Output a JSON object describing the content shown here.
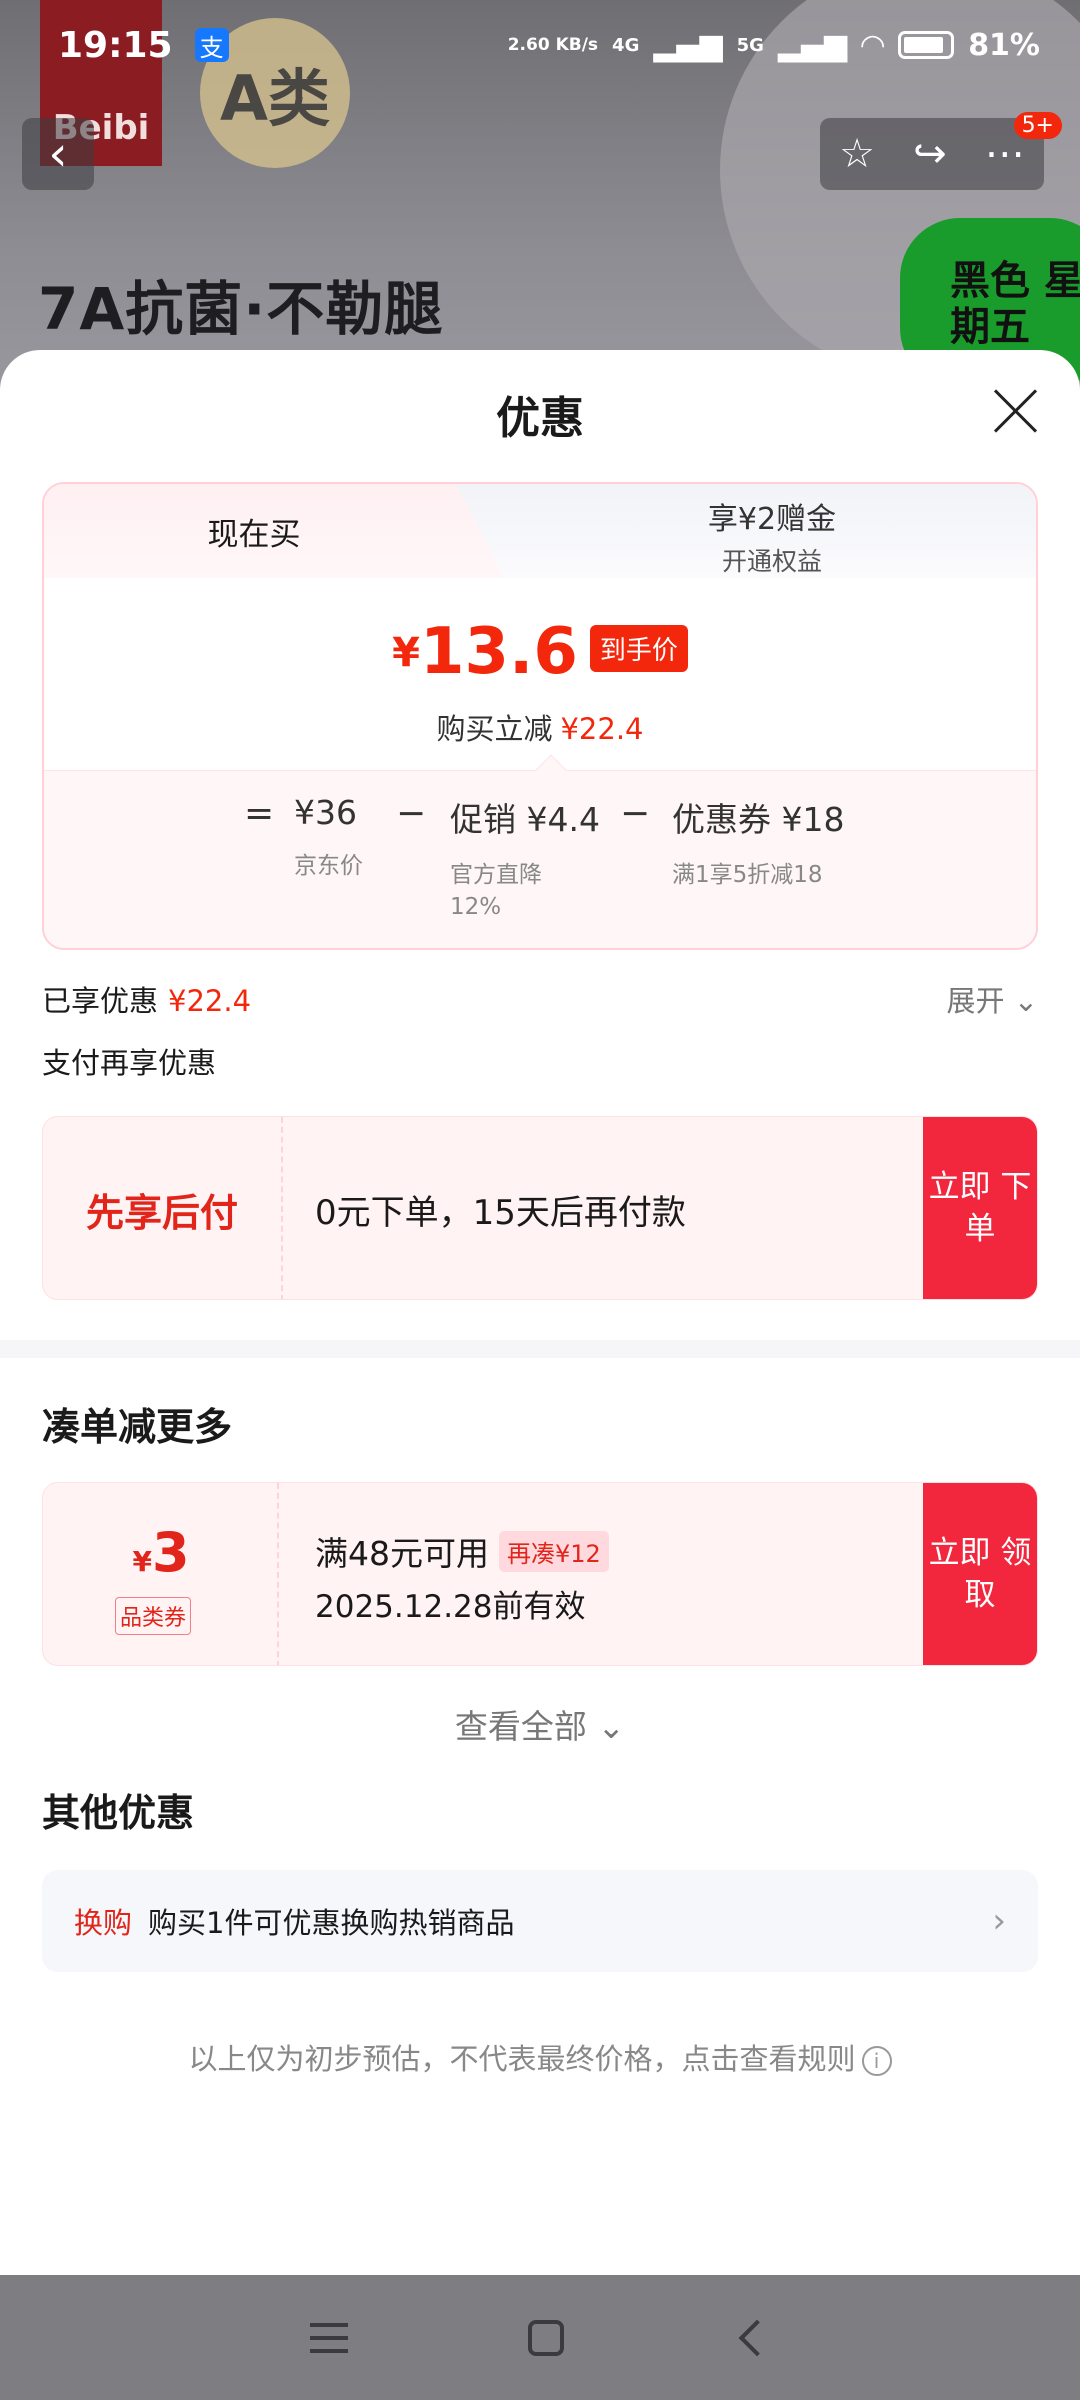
{
  "status_bar": {
    "time": "19:15",
    "app_icon": "支",
    "network_speed": "2.60 KB/s",
    "net_4g": "4G",
    "net_5g": "5G",
    "battery": "81%"
  },
  "background_page": {
    "brand": "Beibi",
    "badge": "A类",
    "headline": "7A抗菌·不勒腿",
    "promo_badge": "黑色 星期五",
    "cart_badge": "5+"
  },
  "sheet": {
    "title": "优惠",
    "tabs": {
      "now": "现在买",
      "gift_title": "享¥2赠金",
      "gift_sub": "开通权益"
    },
    "final_price": {
      "currency": "¥",
      "value": "13.6",
      "tag": "到手价",
      "reduce_label": "购买立减",
      "reduce_amount": "¥22.4"
    },
    "breakdown": {
      "equals": "=",
      "minus": "−",
      "items": [
        {
          "value": "¥36",
          "desc": "京东价"
        },
        {
          "value": "促销 ¥4.4",
          "desc": "官方直降 12%"
        },
        {
          "value": "优惠券 ¥18",
          "desc": "满1享5折减18"
        }
      ]
    },
    "enjoyed": {
      "label": "已享优惠",
      "amount": "¥22.4",
      "expand": "展开"
    },
    "pay_more": {
      "title": "支付再享优惠",
      "bnpl_label": "先享后付",
      "bnpl_desc": "0元下单，15天后再付款",
      "bnpl_button": "立即 下单"
    },
    "bundle": {
      "title": "凑单减更多",
      "coupon": {
        "currency": "¥",
        "value": "3",
        "kind": "品类券",
        "condition": "满48元可用",
        "extra": "再凑¥12",
        "valid": "2025.12.28前有效",
        "button": "立即 领取"
      },
      "view_all": "查看全部"
    },
    "other": {
      "title": "其他优惠",
      "tag": "换购",
      "text": "购买1件可优惠换购热销商品"
    },
    "disclaimer": "以上仅为初步预估，不代表最终价格，点击查看规则"
  }
}
